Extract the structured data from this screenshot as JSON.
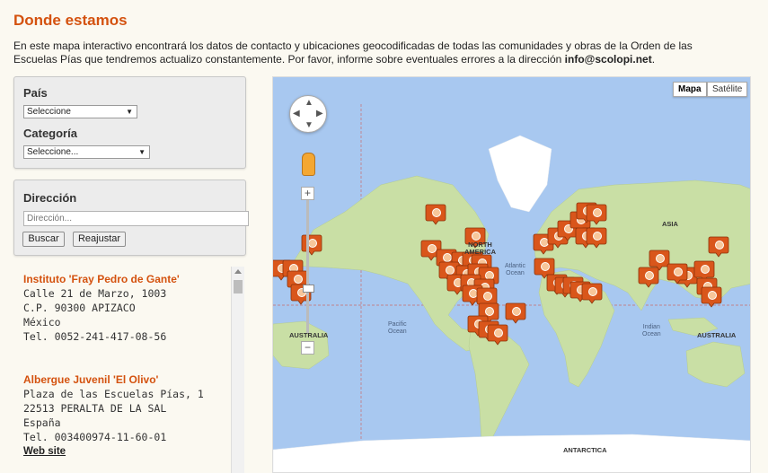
{
  "page": {
    "title": "Donde estamos",
    "intro_text": "En este mapa interactivo encontrará los datos de contacto y ubicaciones geocodificadas de todas las comunidades y obras de la Orden de las Escuelas Pías que tendremos actualizo constantemente. Por favor, informe sobre eventuales errores a la dirección ",
    "intro_email": "info@scolopi.net",
    "intro_end": "."
  },
  "filters": {
    "country_label": "País",
    "country_value": "Seleccione",
    "category_label": "Categoría",
    "category_value": "Seleccione..."
  },
  "address": {
    "label": "Dirección",
    "placeholder": "Dirección...",
    "search_button": "Buscar",
    "reset_button": "Reajustar"
  },
  "results": [
    {
      "name": "Instituto 'Fray Pedro de Gante'",
      "street": "Calle 21 de Marzo, 1003",
      "postal": "C.P. 90300 APIZACO",
      "country": "México",
      "phone": "Tel. 0052-241-417-08-56"
    },
    {
      "name": "Albergue Juvenil 'El Olivo'",
      "street": "Plaza de las Escuelas Pías, 1",
      "postal": "22513 PERALTA DE LA SAL",
      "country": "España",
      "phone": "Tel. 003400974-11-60-01",
      "link": "Web site"
    }
  ],
  "map": {
    "type_map": "Mapa",
    "type_satellite": "Satélite",
    "labels": {
      "north_america": "NORTH\nAMERICA",
      "asia": "ASIA",
      "australia_left": "AUSTRALIA",
      "australia_right": "AUSTRALIA",
      "antarctica": "ANTARCTICA",
      "atlantic": "Atlantic\nOcean",
      "pacific": "Pacific\nOcean",
      "indian": "Indian\nOcean"
    },
    "colors": {
      "water": "#a8c8f0",
      "land": "#c9dfa5",
      "ice": "#ffffff",
      "marker": "#d9561b"
    }
  }
}
